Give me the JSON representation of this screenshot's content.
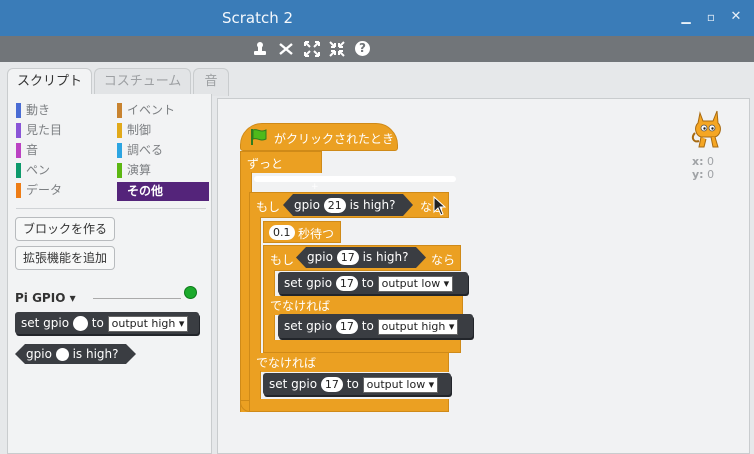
{
  "window": {
    "title": "Scratch 2"
  },
  "window_controls": {
    "help": "?"
  },
  "tabs": [
    "スクリプト",
    "コスチューム",
    "音"
  ],
  "categories": {
    "left": [
      {
        "label": "動き",
        "color": "#4a6cd4"
      },
      {
        "label": "見た目",
        "color": "#8a55d7"
      },
      {
        "label": "音",
        "color": "#bb42c3"
      },
      {
        "label": "ペン",
        "color": "#0e9a6c"
      },
      {
        "label": "データ",
        "color": "#ee7d16"
      }
    ],
    "right": [
      {
        "label": "イベント",
        "color": "#c88330"
      },
      {
        "label": "制御",
        "color": "#e1a91a"
      },
      {
        "label": "調べる",
        "color": "#2ca5e2"
      },
      {
        "label": "演算",
        "color": "#5cb712"
      },
      {
        "label": "その他",
        "color": "#632d99"
      }
    ]
  },
  "palette": {
    "make_block": "ブロックを作る",
    "add_extension": "拡張機能を追加",
    "extension_name": "Pi GPIO",
    "extension_arrow": "▾",
    "set_block": {
      "set": "set",
      "gpio": "gpio",
      "to": "to",
      "mode": "output high"
    },
    "is_high_block": {
      "gpio": "gpio",
      "is_high": "is high?"
    }
  },
  "script": {
    "hat": "がクリックされたとき",
    "forever": "ずっと",
    "if1": {
      "label": "もし",
      "gpio": "gpio",
      "pin": "21",
      "is_high": "is high?",
      "nara": "なら"
    },
    "wait": {
      "value": "0.1",
      "label": "秒待つ"
    },
    "if2": {
      "label": "もし",
      "gpio": "gpio",
      "pin": "17",
      "is_high": "is high?",
      "nara": "なら"
    },
    "set1": {
      "set": "set",
      "gpio": "gpio",
      "pin": "17",
      "to": "to",
      "mode": "output low"
    },
    "else1": "でなければ",
    "set2": {
      "set": "set",
      "gpio": "gpio",
      "pin": "17",
      "to": "to",
      "mode": "output high"
    },
    "else2": "でなければ",
    "set3": {
      "set": "set",
      "gpio": "gpio",
      "pin": "17",
      "to": "to",
      "mode": "output low"
    }
  },
  "stage": {
    "x_label": "x:",
    "x_value": "0",
    "y_label": "y:",
    "y_value": "0"
  }
}
